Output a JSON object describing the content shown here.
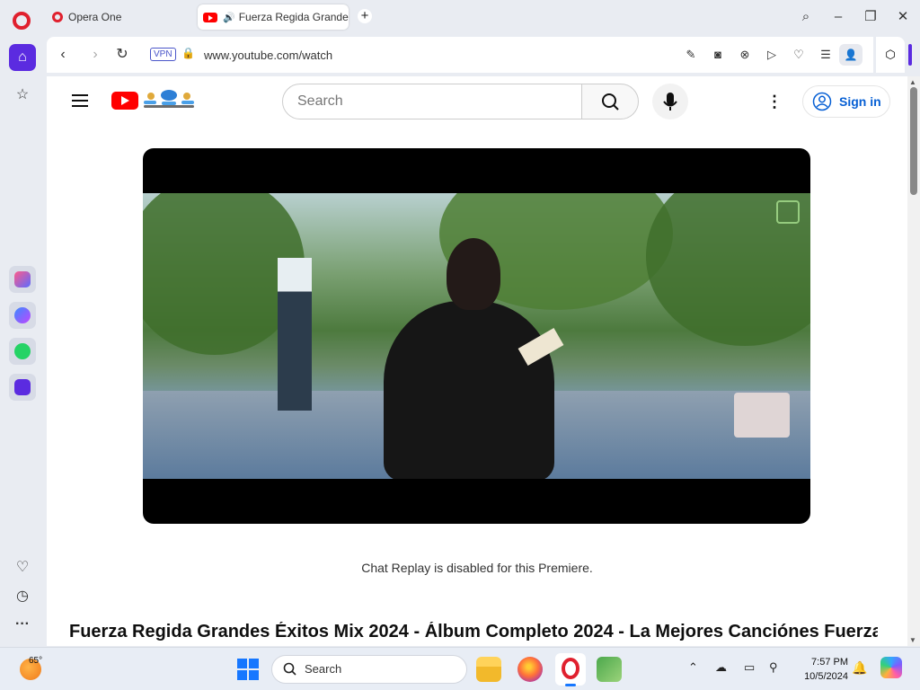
{
  "browser": {
    "tabs": [
      {
        "label": "Opera One"
      },
      {
        "label": "Fuerza Regida Grande"
      }
    ],
    "address": {
      "vpn_label": "VPN",
      "url": "www.youtube.com/watch"
    }
  },
  "youtube": {
    "search_placeholder": "Search",
    "sign_in_label": "Sign in",
    "chat_replay_text": "Chat Replay is disabled for this Premiere.",
    "video_title": "Fuerza Regida Grandes Éxitos Mix 2024 - Álbum Completo 2024 - La Mejores Canciónes Fuerza"
  },
  "taskbar": {
    "weather_temp": "65°",
    "search_label": "Search",
    "time": "7:57 PM",
    "date": "10/5/2024"
  },
  "colors": {
    "opera_red": "#e0202e",
    "opera_accent": "#5b2be0",
    "youtube_red": "#ff0000",
    "signin_blue": "#065fd4",
    "windows_blue": "#1677ff"
  },
  "icons": {
    "sidebar": [
      "home-icon",
      "star-icon",
      "aria-icon",
      "messenger-icon",
      "whatsapp-icon",
      "music-icon",
      "heart-icon",
      "history-icon",
      "more-icon"
    ],
    "toolbar": [
      "edit-icon",
      "camera-icon",
      "shield-icon",
      "play-icon",
      "heart-icon",
      "menu-icon",
      "profile-icon",
      "extensions-icon"
    ]
  }
}
